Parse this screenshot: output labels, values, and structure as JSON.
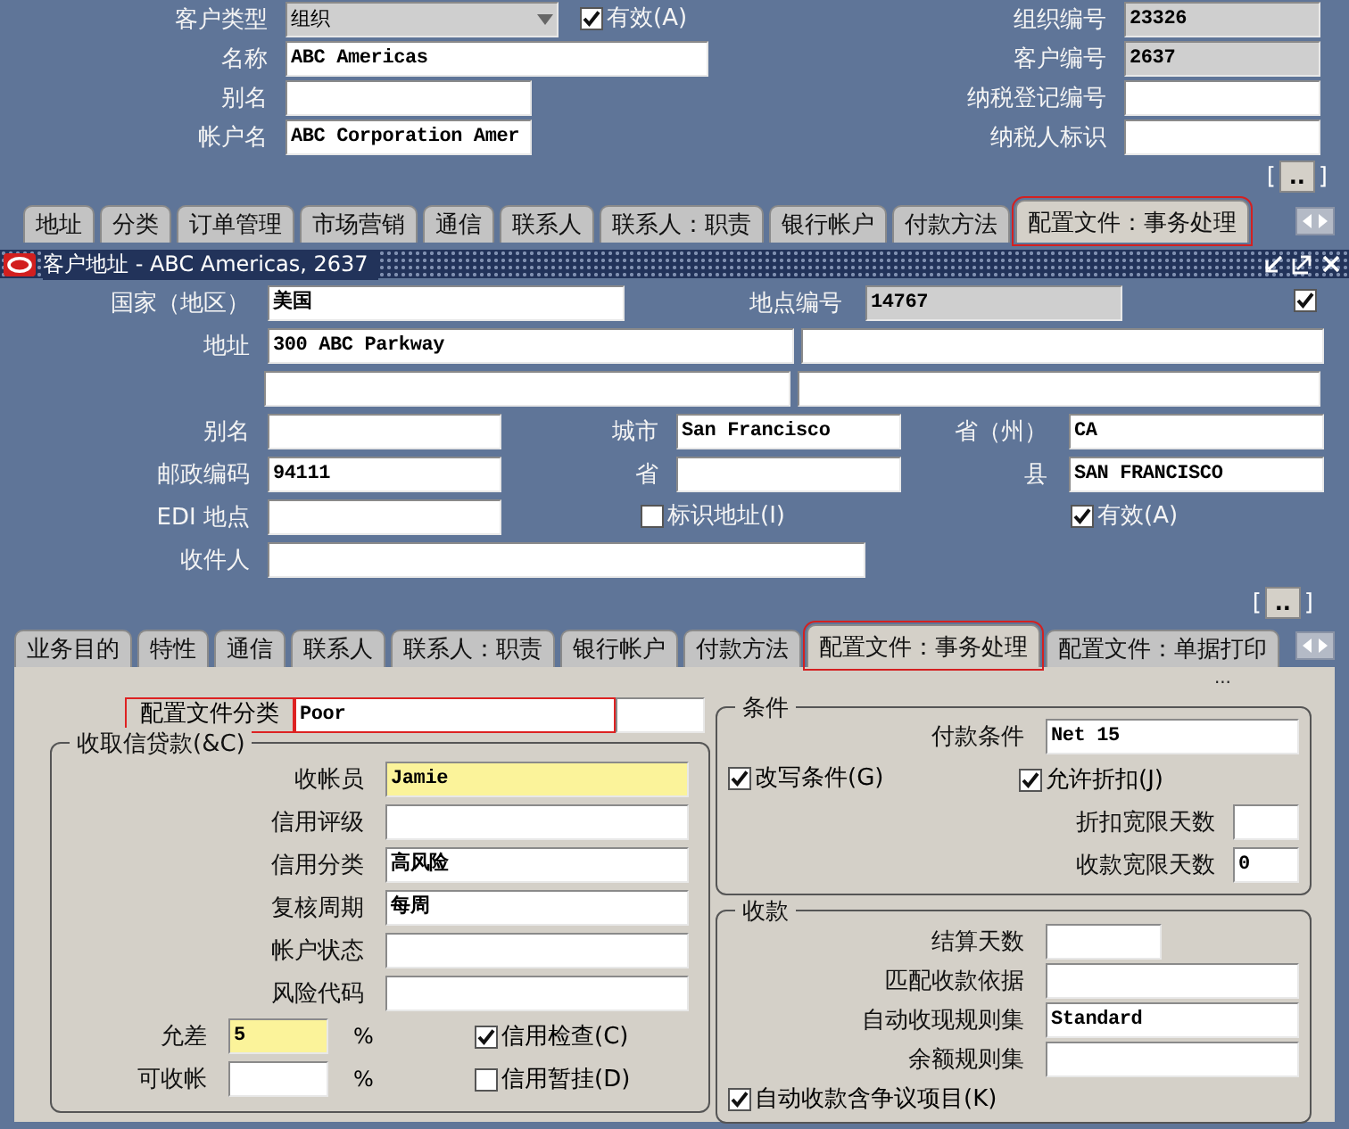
{
  "header": {
    "left": [
      {
        "label": "客户类型",
        "value": "组织",
        "kind": "dropdown"
      },
      {
        "label": "名称",
        "value": "ABC Americas",
        "kind": "text"
      },
      {
        "label": "别名",
        "kind": "text"
      },
      {
        "label": "帐户名",
        "value": "ABC Corporation Amer",
        "kind": "text"
      }
    ],
    "active": {
      "label": "有效(A)",
      "checked": true
    },
    "right": [
      {
        "label": "组织编号",
        "value": "23326",
        "kind": "readonly"
      },
      {
        "label": "客户编号",
        "value": "2637",
        "kind": "readonly"
      },
      {
        "label": "纳税登记编号",
        "kind": "text"
      },
      {
        "label": "纳税人标识",
        "kind": "text"
      }
    ],
    "more": {
      "open": "[",
      "label": "..",
      "close": "]"
    }
  },
  "tabs": [
    {
      "label": "地址",
      "selected": false,
      "highlighted": false
    },
    {
      "label": "分类",
      "selected": false,
      "highlighted": false
    },
    {
      "label": "订单管理",
      "selected": false,
      "highlighted": false
    },
    {
      "label": "市场营销",
      "selected": false,
      "highlighted": false
    },
    {
      "label": "通信",
      "selected": false,
      "highlighted": false
    },
    {
      "label": "联系人",
      "selected": false,
      "highlighted": false
    },
    {
      "label": "联系人：职责",
      "selected": false,
      "highlighted": false
    },
    {
      "label": "银行帐户",
      "selected": false,
      "highlighted": false
    },
    {
      "label": "付款方法",
      "selected": false,
      "highlighted": false
    },
    {
      "label": "配置文件：事务处理",
      "selected": true,
      "highlighted": true
    }
  ],
  "address": {
    "title": "客户地址 - ABC Americas, 2637",
    "country": {
      "label": "国家（地区）",
      "value": "美国"
    },
    "site_number": {
      "label": "地点编号",
      "value": "14767"
    },
    "primary": {
      "checked": true
    },
    "address_label": "地址",
    "line_1": "300 ABC Parkway",
    "alias": {
      "label": "别名"
    },
    "city": {
      "label": "城市",
      "value": "San Francisco"
    },
    "state": {
      "label": "省（州）",
      "value": "CA"
    },
    "postal_code": {
      "label": "邮政编码",
      "value": "94111"
    },
    "province": {
      "label": "省"
    },
    "county": {
      "label": "县",
      "value": "SAN FRANCISCO"
    },
    "edi_location": {
      "label": "EDI 地点"
    },
    "identifying": {
      "label": "标识地址(I)",
      "checked": false
    },
    "active": {
      "label": "有效(A)",
      "checked": true
    },
    "addressee": {
      "label": "收件人"
    },
    "more": {
      "open": "[",
      "label": "..",
      "close": "]"
    }
  },
  "site_tabs": [
    {
      "label": "业务目的",
      "selected": false,
      "highlighted": false
    },
    {
      "label": "特性",
      "selected": false,
      "highlighted": false
    },
    {
      "label": "通信",
      "selected": false,
      "highlighted": false
    },
    {
      "label": "联系人",
      "selected": false,
      "highlighted": false
    },
    {
      "label": "联系人：职责",
      "selected": false,
      "highlighted": false
    },
    {
      "label": "银行帐户",
      "selected": false,
      "highlighted": false
    },
    {
      "label": "付款方法",
      "selected": false,
      "highlighted": false
    },
    {
      "label": "配置文件：事务处理",
      "selected": true,
      "highlighted": true
    },
    {
      "label": "配置文件：单据打印",
      "selected": false,
      "highlighted": false
    }
  ],
  "profile": {
    "profile_class": {
      "label": "配置文件分类",
      "value": "Poor",
      "highlighted": true
    },
    "ellipsis": "...",
    "credit": {
      "title": "收取信贷款(&C)",
      "fields": [
        {
          "label": "收帐员",
          "value": "Jamie",
          "required": true
        },
        {
          "label": "信用评级",
          "required": false
        },
        {
          "label": "信用分类",
          "value": "高风险",
          "required": false
        },
        {
          "label": "复核周期",
          "value": "每周",
          "required": false
        },
        {
          "label": "帐户状态",
          "required": false
        },
        {
          "label": "风险代码",
          "required": false
        }
      ],
      "tolerance": {
        "label": "允差",
        "value": "5",
        "unit": "%",
        "required": true
      },
      "receivable": {
        "label": "可收帐",
        "unit": "%",
        "required": false
      },
      "credit_check": {
        "label": "信用检查(C)",
        "checked": true
      },
      "credit_hold": {
        "label": "信用暂挂(D)",
        "checked": false
      }
    },
    "terms": {
      "title": "条件",
      "payment_terms": {
        "label": "付款条件",
        "value": "Net 15"
      },
      "override": {
        "label": "改写条件(G)",
        "checked": true
      },
      "allow_discount": {
        "label": "允许折扣(J)",
        "checked": true
      },
      "discount_grace": {
        "label": "折扣宽限天数"
      },
      "receipt_grace": {
        "label": "收款宽限天数",
        "value": "0"
      }
    },
    "receipts": {
      "title": "收款",
      "fields": [
        {
          "label": "结算天数"
        },
        {
          "label": "匹配收款依据"
        },
        {
          "label": "自动收现规则集",
          "value": "Standard"
        },
        {
          "label": "余额规则集"
        }
      ],
      "include_disputed": {
        "label": "自动收款含争议项目(K)",
        "checked": true
      }
    }
  }
}
